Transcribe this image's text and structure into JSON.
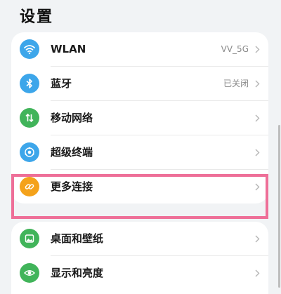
{
  "header": {
    "title": "设置"
  },
  "settings_groups": [
    {
      "items": [
        {
          "label": "WLAN",
          "value": "VV_5G",
          "icon": "wifi-icon",
          "icon_color": "#3da6ea"
        },
        {
          "label": "蓝牙",
          "value": "已关闭",
          "icon": "bluetooth-icon",
          "icon_color": "#3da6ea"
        },
        {
          "label": "移动网络",
          "value": "",
          "icon": "mobile-network-icon",
          "icon_color": "#41b45a"
        },
        {
          "label": "超级终端",
          "value": "",
          "icon": "super-device-icon",
          "icon_color": "#3da6ea"
        },
        {
          "label": "更多连接",
          "value": "",
          "icon": "link-icon",
          "icon_color": "#f4a21b",
          "highlighted": true
        }
      ]
    },
    {
      "items": [
        {
          "label": "桌面和壁纸",
          "value": "",
          "icon": "wallpaper-icon",
          "icon_color": "#41b45a"
        },
        {
          "label": "显示和亮度",
          "value": "",
          "icon": "eye-icon",
          "icon_color": "#41b45a"
        }
      ]
    }
  ],
  "highlight_color": "#ee6f98"
}
